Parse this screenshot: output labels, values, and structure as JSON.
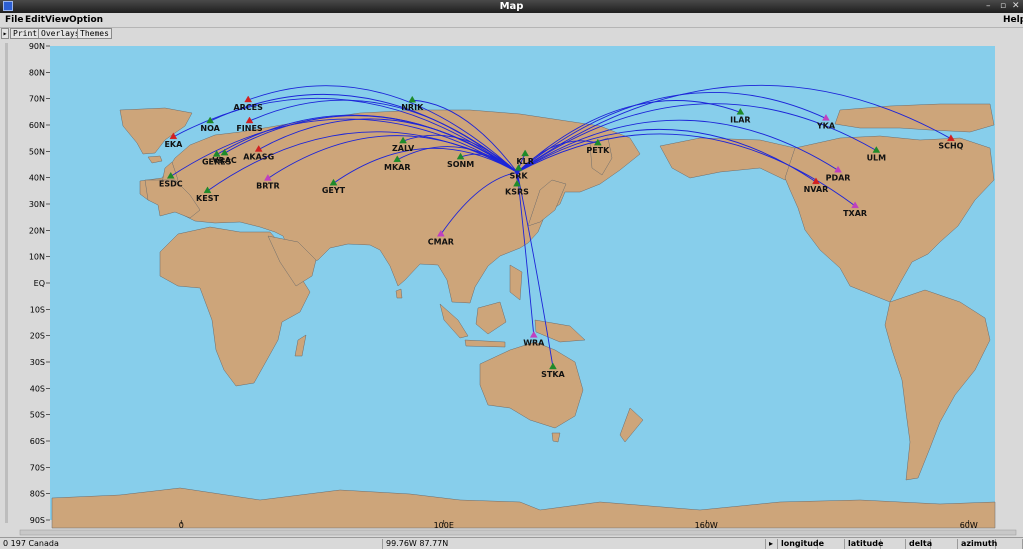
{
  "window": {
    "title": "Map"
  },
  "menubar": {
    "file": "File",
    "edit": "Edit",
    "view": "View",
    "option": "Option",
    "help": "Help"
  },
  "toolbar": {
    "print": "Print",
    "overlays": "Overlays",
    "themes": "Themes"
  },
  "colors": {
    "ocean": "#87ceeb",
    "land": "#cda57a",
    "path": "#1c24d8",
    "frame": "#d9d9d9"
  },
  "map": {
    "lat_labels": [
      "90N",
      "80N",
      "70N",
      "60N",
      "50N",
      "40N",
      "30N",
      "20N",
      "10N",
      "EQ",
      "10S",
      "20S",
      "30S",
      "40S",
      "50S",
      "60S",
      "70S",
      "80S",
      "90S"
    ],
    "lon_labels": [
      {
        "text": "0",
        "lon": 0
      },
      {
        "text": "100E",
        "lon": 100
      },
      {
        "text": "160W",
        "lon": 200
      },
      {
        "text": "60W",
        "lon": 300
      }
    ],
    "lon_range": [
      -50,
      310
    ],
    "lat_range": [
      -90,
      90
    ],
    "hub": {
      "lon": 128,
      "lat": 42
    },
    "stations": [
      {
        "name": "EKA",
        "lon": -3,
        "lat": 55.5,
        "color": "#d22020"
      },
      {
        "name": "NOA",
        "lon": 11,
        "lat": 61.5,
        "color": "#1e8a2a"
      },
      {
        "name": "ARCES",
        "lon": 25.5,
        "lat": 69.5,
        "color": "#d22020"
      },
      {
        "name": "FINES",
        "lon": 26,
        "lat": 61.5,
        "color": "#d22020"
      },
      {
        "name": "GERES",
        "lon": 13.5,
        "lat": 48.8,
        "color": "#1e8a2a"
      },
      {
        "name": "VRAC",
        "lon": 16.5,
        "lat": 49.3,
        "color": "#1e8a2a"
      },
      {
        "name": "AKASG",
        "lon": 29.5,
        "lat": 50.7,
        "color": "#d22020"
      },
      {
        "name": "ESDC",
        "lon": -4,
        "lat": 40.5,
        "color": "#1e8a2a"
      },
      {
        "name": "KEST",
        "lon": 10,
        "lat": 35,
        "color": "#1e8a2a"
      },
      {
        "name": "BRTR",
        "lon": 33,
        "lat": 39.7,
        "color": "#c040c0"
      },
      {
        "name": "GEYT",
        "lon": 58,
        "lat": 37.9,
        "color": "#1e8a2a"
      },
      {
        "name": "ZALV",
        "lon": 84.5,
        "lat": 53.9,
        "color": "#1e8a2a"
      },
      {
        "name": "NRIK",
        "lon": 88,
        "lat": 69.4,
        "color": "#1e8a2a"
      },
      {
        "name": "MKAR",
        "lon": 82.3,
        "lat": 46.8,
        "color": "#1e8a2a"
      },
      {
        "name": "SONM",
        "lon": 106.4,
        "lat": 47.8,
        "color": "#1e8a2a"
      },
      {
        "name": "KLR",
        "lon": 131,
        "lat": 49,
        "color": "#1e8a2a"
      },
      {
        "name": "SRK",
        "lon": 128.5,
        "lat": 43.5,
        "color": "#1e8a2a"
      },
      {
        "name": "KSRS",
        "lon": 127.9,
        "lat": 37.5,
        "color": "#1e8a2a"
      },
      {
        "name": "CMAR",
        "lon": 98.9,
        "lat": 18.5,
        "color": "#c040c0"
      },
      {
        "name": "PETK",
        "lon": 158.7,
        "lat": 53.1,
        "color": "#1e8a2a"
      },
      {
        "name": "ILAR",
        "lon": 213,
        "lat": 64.8,
        "color": "#1e8a2a"
      },
      {
        "name": "YKA",
        "lon": 245.6,
        "lat": 62.5,
        "color": "#c040c0"
      },
      {
        "name": "ULM",
        "lon": 264.8,
        "lat": 50.3,
        "color": "#1e8a2a"
      },
      {
        "name": "SCHQ",
        "lon": 293.2,
        "lat": 54.8,
        "color": "#d22020"
      },
      {
        "name": "PDAR",
        "lon": 250.2,
        "lat": 42.8,
        "color": "#c040c0"
      },
      {
        "name": "NVAR",
        "lon": 241.8,
        "lat": 38.4,
        "color": "#d22020"
      },
      {
        "name": "TXAR",
        "lon": 256.7,
        "lat": 29.3,
        "color": "#c040c0"
      },
      {
        "name": "WRA",
        "lon": 134.3,
        "lat": -19.9,
        "color": "#c040c0"
      },
      {
        "name": "STKA",
        "lon": 141.6,
        "lat": -31.9,
        "color": "#1e8a2a"
      }
    ]
  },
  "status": {
    "cursor_info": "0 197 Canada",
    "cursor_coords": "99.76W  87.77N",
    "arrow": "▸",
    "longitude_label": "longitude",
    "latitude_label": "latitude",
    "delta_label": "delta",
    "azimuth_label": "azimuth"
  }
}
